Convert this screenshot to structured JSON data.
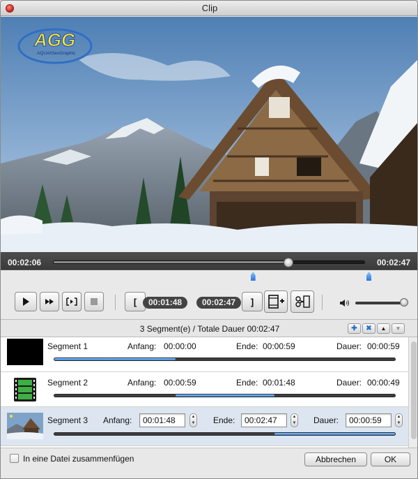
{
  "window": {
    "title": "Clip"
  },
  "video": {
    "logo_text": "AGG",
    "logo_subtext": "AQUA/GeoGraphic"
  },
  "timeline": {
    "current_time": "00:02:06",
    "total_time": "00:02:47",
    "playhead_fraction": 0.755,
    "start_marker_fraction": 0.64,
    "end_marker_fraction": 1.0
  },
  "controls": {
    "play_icon": "play-icon",
    "fast_forward_icon": "fast-forward-icon",
    "frame_step_icon": "frame-step-icon",
    "stop_icon": "stop-icon",
    "set_start_label": "[",
    "start_time": "00:01:48",
    "end_time": "00:02:47",
    "set_end_label": "]",
    "volume_fraction": 0.97
  },
  "segments_header": {
    "summary": "3 Segment(e) / Totale Dauer 00:02:47"
  },
  "segments": [
    {
      "name": "Segment 1",
      "start_label": "Anfang:",
      "start": "00:00:00",
      "end_label": "Ende:",
      "end": "00:00:59",
      "duration_label": "Dauer:",
      "duration": "00:00:59",
      "range": [
        0.0,
        0.356
      ]
    },
    {
      "name": "Segment 2",
      "start_label": "Anfang:",
      "start": "00:00:59",
      "end_label": "Ende:",
      "end": "00:01:48",
      "duration_label": "Dauer:",
      "duration": "00:00:49",
      "range": [
        0.356,
        0.647
      ]
    },
    {
      "name": "Segment 3",
      "start_label": "Anfang:",
      "start": "00:01:48",
      "end_label": "Ende:",
      "end": "00:02:47",
      "duration_label": "Dauer:",
      "duration": "00:00:59",
      "range": [
        0.647,
        1.0
      ]
    }
  ],
  "footer": {
    "merge_label": "In eine Datei zusammenfügen",
    "merge_checked": false,
    "cancel_label": "Abbrechen",
    "ok_label": "OK"
  }
}
